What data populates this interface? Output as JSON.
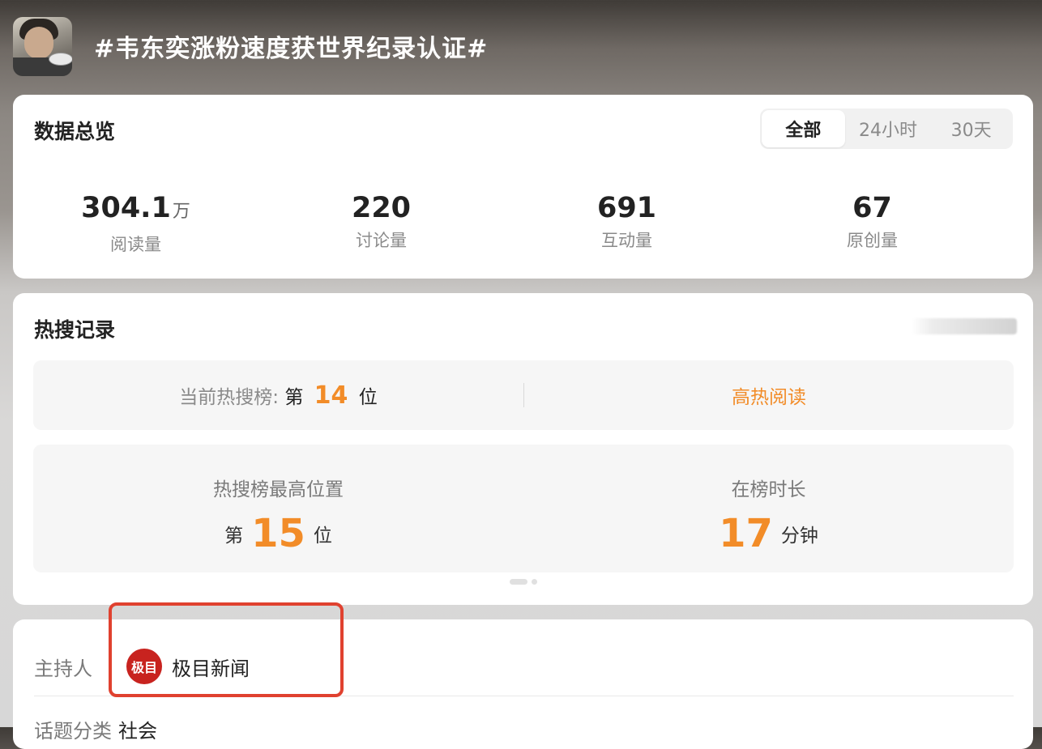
{
  "header": {
    "topic_title": "#韦东奕涨粉速度获世界纪录认证#"
  },
  "overview": {
    "title": "数据总览",
    "tabs": [
      {
        "label": "全部",
        "active": true
      },
      {
        "label": "24小时",
        "active": false
      },
      {
        "label": "30天",
        "active": false
      }
    ],
    "stats": [
      {
        "value": "304.1",
        "unit": "万",
        "label": "阅读量"
      },
      {
        "value": "220",
        "unit": "",
        "label": "讨论量"
      },
      {
        "value": "691",
        "unit": "",
        "label": "互动量"
      },
      {
        "value": "67",
        "unit": "",
        "label": "原创量"
      }
    ]
  },
  "hot_search": {
    "title": "热搜记录",
    "current_rank": {
      "label": "当前热搜榜:",
      "prefix": "第",
      "rank": "14",
      "suffix": "位"
    },
    "read_link": "高热阅读",
    "best_position": {
      "label": "热搜榜最高位置",
      "prefix": "第",
      "value": "15",
      "suffix": "位"
    },
    "duration": {
      "label": "在榜时长",
      "value": "17",
      "unit": "分钟"
    }
  },
  "host": {
    "label": "主持人",
    "avatar_text": "极目",
    "name": "极目新闻"
  },
  "category": {
    "label": "话题分类",
    "value": "社会"
  },
  "colors": {
    "accent_orange": "#f28c28",
    "highlight_red": "#e0412f",
    "host_logo_red": "#c8231f"
  }
}
